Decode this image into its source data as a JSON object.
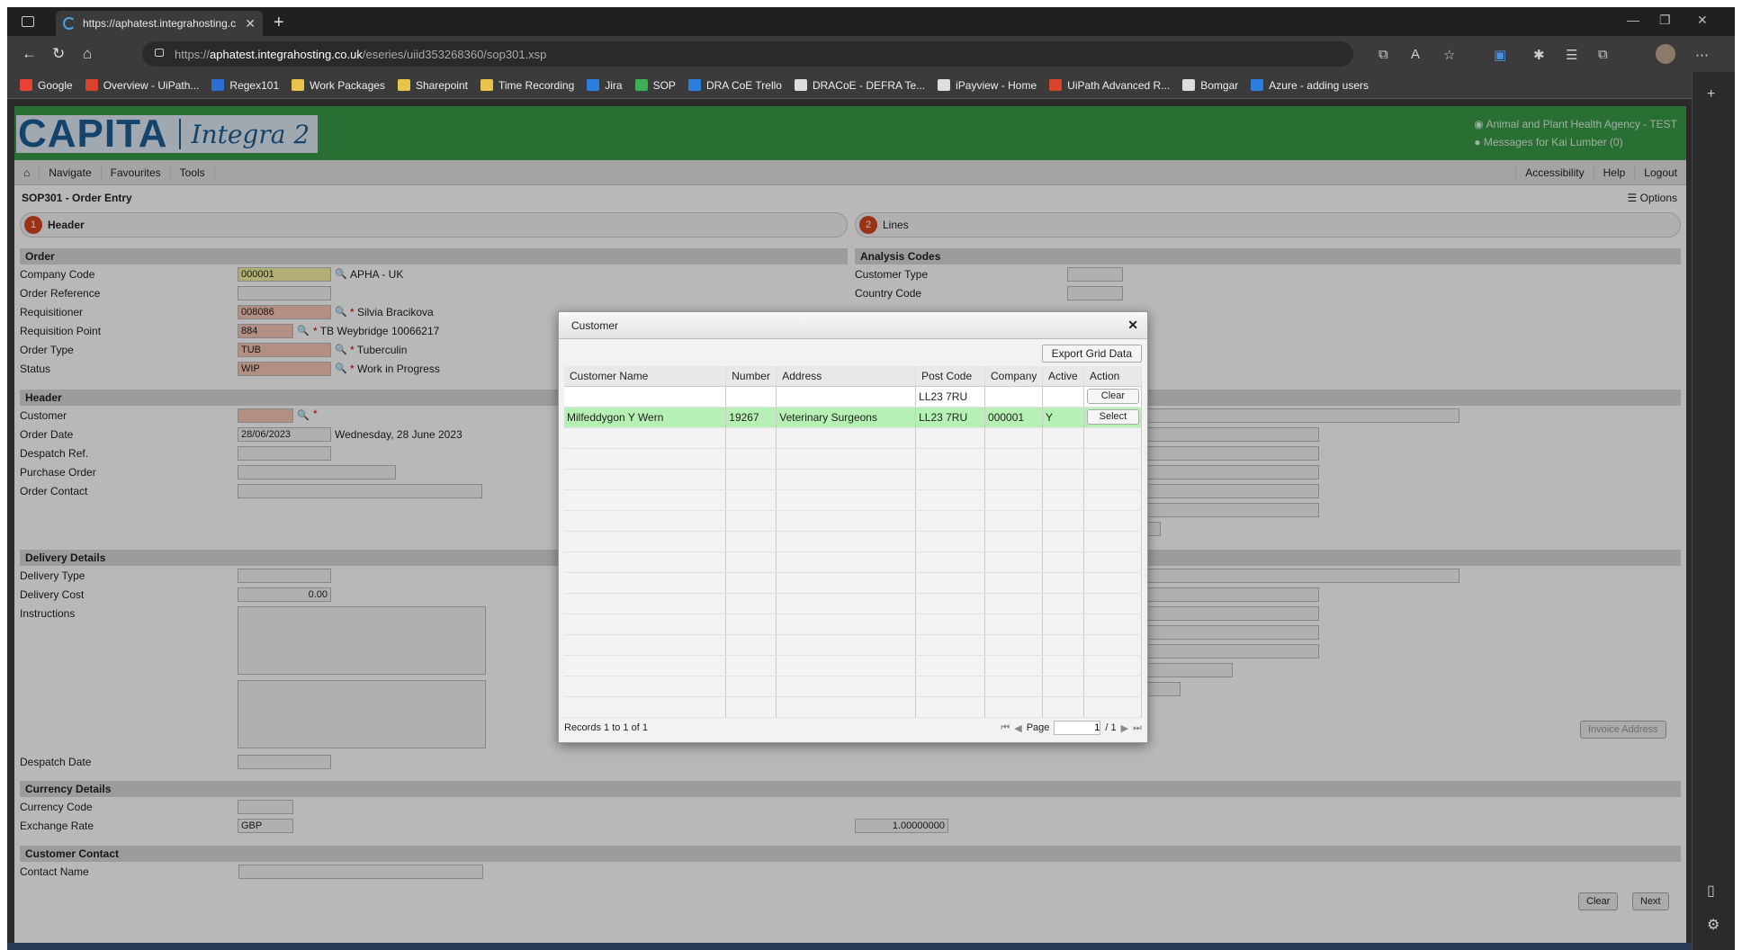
{
  "browser": {
    "tab_title": "https://aphatest.integrahosting.c",
    "url_prefix": "https://",
    "url_host": "aphatest.integrahosting.co.uk",
    "url_path": "/eseries/uiid353268360/sop301.xsp",
    "bookmarks": [
      {
        "label": "Google",
        "color": "#e94235"
      },
      {
        "label": "Overview - UiPath...",
        "color": "#d9442b"
      },
      {
        "label": "Regex101",
        "color": "#2b6fd6"
      },
      {
        "label": "Work Packages",
        "color": "#e8c54a"
      },
      {
        "label": "Sharepoint",
        "color": "#e8c54a"
      },
      {
        "label": "Time Recording",
        "color": "#e8c54a"
      },
      {
        "label": "Jira",
        "color": "#2b7de0"
      },
      {
        "label": "SOP",
        "color": "#3cae55"
      },
      {
        "label": "DRA CoE Trello",
        "color": "#2b7de0"
      },
      {
        "label": "DRACoE - DEFRA Te...",
        "color": "#dddddd"
      },
      {
        "label": "iPayview - Home",
        "color": "#dddddd"
      },
      {
        "label": "UiPath Advanced R...",
        "color": "#d9442b"
      },
      {
        "label": "Bomgar",
        "color": "#dddddd"
      },
      {
        "label": "Azure - adding users",
        "color": "#2b7de0"
      }
    ]
  },
  "app": {
    "brand": "CAPITA",
    "product": "Integra 2",
    "org": "Animal and Plant Health Agency - TEST",
    "messages": "Messages for Kai Lumber (0)",
    "menu": [
      "Navigate",
      "Favourites",
      "Tools"
    ],
    "menu_right": [
      "Accessibility",
      "Help",
      "Logout"
    ],
    "page_title": "SOP301 - Order Entry",
    "options": "Options",
    "steps": [
      {
        "num": "1",
        "label": "Header"
      },
      {
        "num": "2",
        "label": "Lines"
      }
    ]
  },
  "order": {
    "section": "Order",
    "company_code_label": "Company Code",
    "company_code": "000001",
    "company_name": "APHA - UK",
    "order_ref_label": "Order Reference",
    "requisitioner_label": "Requisitioner",
    "requisitioner": "008086",
    "requisitioner_name": "Silvia Bracikova",
    "req_point_label": "Requisition Point",
    "req_point": "884",
    "req_point_name": "TB Weybridge 10066217",
    "order_type_label": "Order Type",
    "order_type": "TUB",
    "order_type_name": "Tuberculin",
    "status_label": "Status",
    "status": "WIP",
    "status_name": "Work in Progress"
  },
  "analysis": {
    "section": "Analysis Codes",
    "customer_type_label": "Customer Type",
    "country_code_label": "Country Code"
  },
  "header": {
    "section": "Header",
    "customer_label": "Customer",
    "order_date_label": "Order Date",
    "order_date": "28/06/2023",
    "order_date_long": "Wednesday, 28 June 2023",
    "despatch_ref_label": "Despatch Ref.",
    "purchase_order_label": "Purchase Order",
    "order_contact_label": "Order Contact"
  },
  "delivery": {
    "section": "Delivery Details",
    "type_label": "Delivery Type",
    "cost_label": "Delivery Cost",
    "cost": "0.00",
    "instructions_label": "Instructions",
    "despatch_date_label": "Despatch Date"
  },
  "currency": {
    "section": "Currency Details",
    "code_label": "Currency Code",
    "rate_label": "Exchange Rate",
    "code": "GBP",
    "rate": "1.00000000"
  },
  "contact": {
    "section": "Customer Contact",
    "name_label": "Contact Name"
  },
  "footer": {
    "clear": "Clear",
    "next": "Next",
    "invoice_address": "Invoice Address"
  },
  "modal": {
    "title": "Customer",
    "export": "Export Grid Data",
    "columns": [
      "Customer Name",
      "Number",
      "Address",
      "Post Code",
      "Company",
      "Active",
      "Action"
    ],
    "filter_postcode": "LL23 7RU",
    "filter_clear": "Clear",
    "rows": [
      {
        "name": "Milfeddygon Y Wern",
        "number": "19267",
        "address": "Veterinary Surgeons",
        "postcode": "LL23 7RU",
        "company": "000001",
        "active": "Y",
        "action": "Select"
      }
    ],
    "records": "Records 1 to 1 of 1",
    "page_label": "Page",
    "page_value": "1",
    "page_total": "/ 1"
  }
}
